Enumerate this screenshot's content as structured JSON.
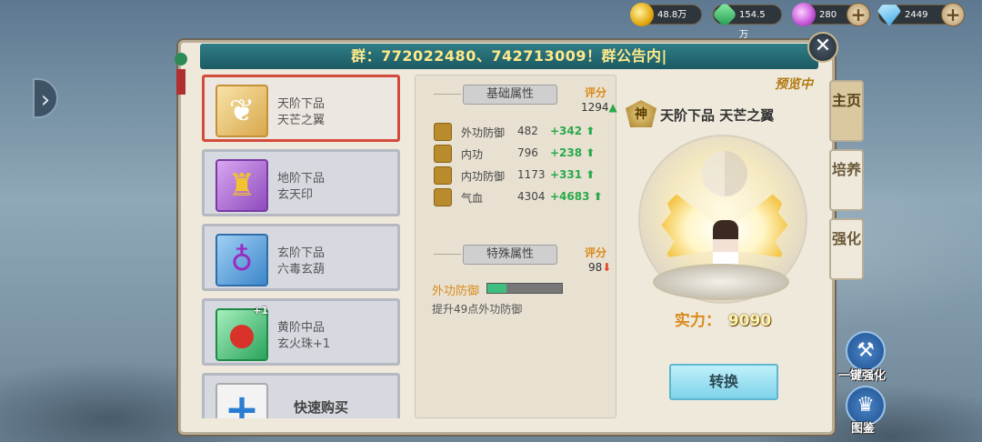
{
  "resources": [
    {
      "icon": "gold-coin-icon",
      "value": "48.8万",
      "plus": false
    },
    {
      "icon": "jade-icon",
      "value": "154.5万",
      "plus": false
    },
    {
      "icon": "spirit-orb-icon",
      "value": "280",
      "plus": true
    },
    {
      "icon": "diamond-icon",
      "value": "2449",
      "plus": true
    }
  ],
  "plus_symbol": "+",
  "banner": "群：772022480、742713009！群公告内|",
  "close_symbol": "✕",
  "items": [
    {
      "line1": "天阶下品",
      "line2": "天芒之翼",
      "quality": "gold",
      "icon": "wing-icon",
      "badge": "",
      "selected": true
    },
    {
      "line1": "地阶下品",
      "line2": "玄天印",
      "quality": "purple",
      "icon": "seal-icon",
      "badge": "",
      "selected": false
    },
    {
      "line1": "玄阶下品",
      "line2": "六毒玄葫",
      "quality": "blue",
      "icon": "gourd-icon",
      "badge": "",
      "selected": false
    },
    {
      "line1": "黄阶中品",
      "line2": "玄火珠+1",
      "quality": "green",
      "icon": "fire-orb-icon",
      "badge": "+1",
      "selected": false
    }
  ],
  "quick_buy": {
    "label": "快速购买",
    "icon": "plus-icon"
  },
  "base_stats": {
    "title": "基础属性",
    "score_label": "评分",
    "score_value": "1294",
    "score_trend": "up",
    "rows": [
      {
        "name": "外功防御",
        "value": "482",
        "delta": "+342",
        "icon": "armor-icon"
      },
      {
        "name": "内功",
        "value": "796",
        "delta": "+238",
        "icon": "inner-power-icon"
      },
      {
        "name": "内功防御",
        "value": "1173",
        "delta": "+331",
        "icon": "shield-icon"
      },
      {
        "name": "气血",
        "value": "4304",
        "delta": "+4683",
        "icon": "heart-icon"
      }
    ]
  },
  "special_stats": {
    "title": "特殊属性",
    "score_label": "评分",
    "score_value": "98",
    "score_trend": "down",
    "name": "外功防御",
    "progress": 0.25,
    "description": "提升49点外功防御"
  },
  "preview": {
    "tag": "预览中",
    "badge": "神",
    "title": "天阶下品 天芒之翼",
    "power_label": "实力：",
    "power_value": "9090",
    "swap_label": "转换"
  },
  "tabs": [
    {
      "label": "主页",
      "active": true
    },
    {
      "label": "培养",
      "active": false
    },
    {
      "label": "强化",
      "active": false
    }
  ],
  "side_buttons": [
    {
      "label": "一键强化",
      "icon": "hammer-icon"
    },
    {
      "label": "图鉴",
      "icon": "book-icon"
    }
  ],
  "colors": {
    "accent_orange": "#d98a1a",
    "up_green": "#2aa94a",
    "down_red": "#e04a2a",
    "banner_text": "#ffe98a"
  }
}
